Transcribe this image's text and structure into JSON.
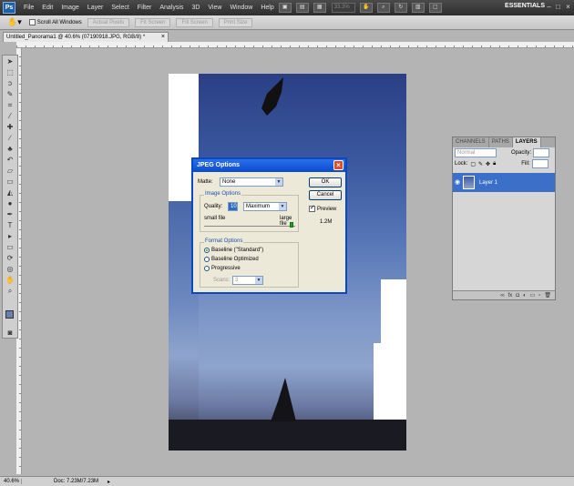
{
  "menubar": {
    "logo": "Ps",
    "items": [
      "File",
      "Edit",
      "Image",
      "Layer",
      "Select",
      "Filter",
      "Analysis",
      "3D",
      "View",
      "Window",
      "Help"
    ],
    "zoom": "33.3%",
    "workspace": "ESSENTIALS"
  },
  "optionsbar": {
    "scroll_all": "Scroll All Windows",
    "buttons": [
      "Actual Pixels",
      "Fit Screen",
      "Fill Screen",
      "Print Size"
    ]
  },
  "document": {
    "tab_title": "Untitled_Panorama1 @ 40.6% (07190918.JPG, RGB/8) *"
  },
  "dialog": {
    "title": "JPEG Options",
    "matte_label": "Matte:",
    "matte_value": "None",
    "ok_label": "OK",
    "cancel_label": "Cancel",
    "preview_label": "Preview",
    "file_size": "1.2M",
    "image_options": {
      "title": "Image Options",
      "quality_label": "Quality:",
      "quality_value": "10",
      "quality_preset": "Maximum",
      "small_file": "small file",
      "large_file": "large file"
    },
    "format_options": {
      "title": "Format Options",
      "baseline_standard": "Baseline (\"Standard\")",
      "baseline_optimized": "Baseline Optimized",
      "progressive": "Progressive",
      "scans_label": "Scans:",
      "scans_value": "3"
    }
  },
  "layers_panel": {
    "tabs": [
      "CHANNELS",
      "PATHS",
      "LAYERS"
    ],
    "blend_mode": "Normal",
    "opacity_label": "Opacity:",
    "lock_label": "Lock:",
    "fill_label": "Fill:",
    "layer_name": "Layer 1"
  },
  "statusbar": {
    "zoom": "40.6%",
    "doc_info": "Doc: 7.23M/7.23M"
  }
}
